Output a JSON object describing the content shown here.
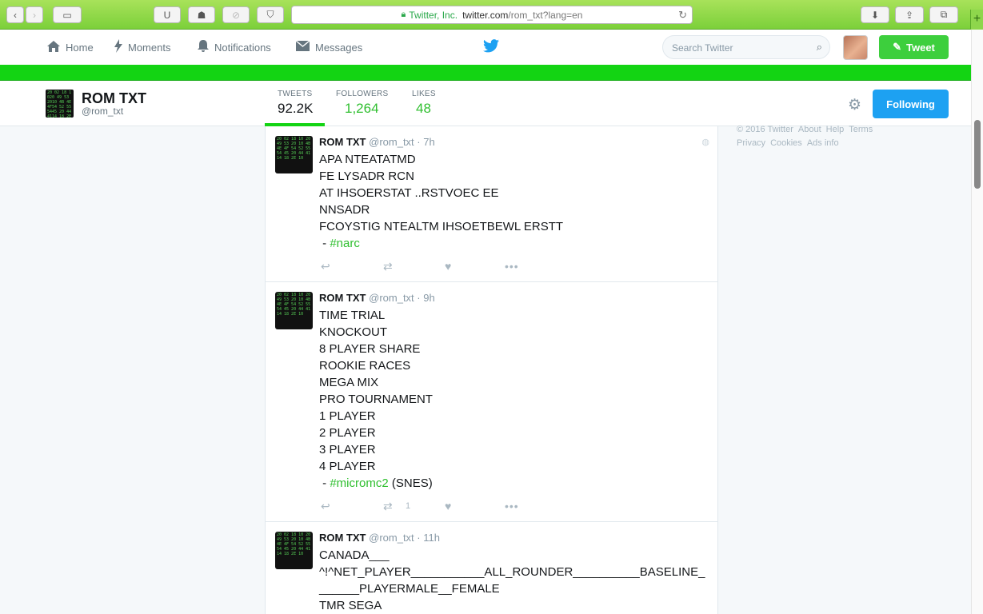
{
  "browser": {
    "url_org": "Twitter, Inc.",
    "url_host": "twitter.com",
    "url_path": "/rom_txt?lang=en"
  },
  "nav": {
    "home": "Home",
    "moments": "Moments",
    "notifications": "Notifications",
    "messages": "Messages",
    "search_placeholder": "Search Twitter",
    "tweet_button": "Tweet"
  },
  "profile": {
    "name": "ROM TXT",
    "handle": "@rom_txt",
    "stats": [
      {
        "label": "TWEETS",
        "value": "92.2K"
      },
      {
        "label": "FOLLOWERS",
        "value": "1,264"
      },
      {
        "label": "LIKES",
        "value": "48"
      }
    ],
    "follow_button": "Following"
  },
  "footer": {
    "links": [
      "© 2016 Twitter",
      "About",
      "Help",
      "Terms",
      "Privacy",
      "Cookies",
      "Ads info"
    ]
  },
  "tweets": [
    {
      "name": "ROM TXT",
      "handle": "@rom_txt",
      "time": "· 7h",
      "lines": [
        "APA NTEATATMD",
        "FE LYSADR RCN",
        "AT IHSOERSTAT ..RSTVOEC EE",
        "NNSADR",
        "FCOYSTIG NTEALTM IHSOETBEWL ERSTT"
      ],
      "hashtag": "#narc",
      "suffix": "",
      "retweets": ""
    },
    {
      "name": "ROM TXT",
      "handle": "@rom_txt",
      "time": "· 9h",
      "lines": [
        "TIME TRIAL",
        "KNOCKOUT",
        "8 PLAYER SHARE",
        "ROOKIE RACES",
        "MEGA MIX",
        "PRO TOURNAMENT",
        "1 PLAYER",
        "2 PLAYER",
        "3 PLAYER",
        "4 PLAYER"
      ],
      "hashtag": "#micromc2",
      "suffix": " (SNES)",
      "retweets": "1"
    },
    {
      "name": "ROM TXT",
      "handle": "@rom_txt",
      "time": "· 11h",
      "lines": [
        "CANADA___",
        "^!^NET_PLAYER___________ALL_ROUNDER__________BASELINE_",
        "______PLAYERMALE__FEMALE",
        "TMR SEGA"
      ],
      "hashtag": "",
      "suffix": "",
      "retweets": ""
    }
  ]
}
